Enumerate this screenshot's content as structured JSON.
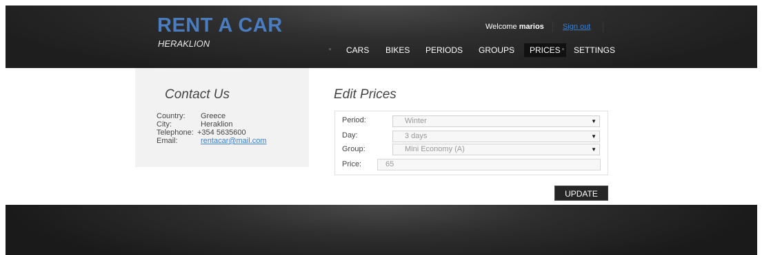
{
  "header": {
    "brand_title": "RENT A CAR",
    "brand_subtitle": "HERAKLION",
    "welcome_prefix": "Welcome",
    "username": "marios",
    "signout_label": "Sign out",
    "brand_color": "#4a7cc0"
  },
  "nav": {
    "items": [
      {
        "label": "CARS"
      },
      {
        "label": "BIKES"
      },
      {
        "label": "PERIODS"
      },
      {
        "label": "GROUPS"
      },
      {
        "label": "PRICES",
        "active": true
      },
      {
        "label": "SETTINGS"
      }
    ]
  },
  "sidebar": {
    "title": "Contact Us",
    "country_label": "Country:",
    "country_value": "Greece",
    "city_label": "City:",
    "city_value": "Heraklion",
    "telephone_label": "Telephone:",
    "telephone_value": "+354 5635600",
    "email_label": "Email:",
    "email_value": "rentacar@mail.com"
  },
  "form": {
    "title": "Edit Prices",
    "period_label": "Period:",
    "period_value": "Winter",
    "day_label": "Day:",
    "day_value": "3 days",
    "group_label": "Group:",
    "group_value": "Mini Economy (A)",
    "price_label": "Price:",
    "price_value": "65",
    "update_label": "UPDATE"
  }
}
